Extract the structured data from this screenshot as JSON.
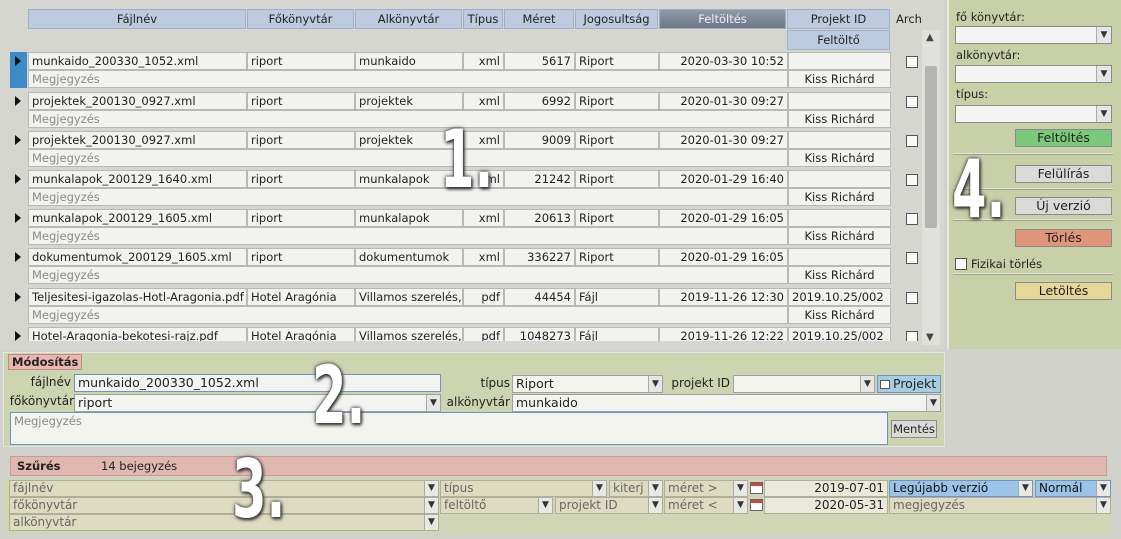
{
  "columns": {
    "filename": "Fájlnév",
    "main_dir": "Főkönyvtár",
    "sub_dir": "Alkönyvtár",
    "type": "Típus",
    "size": "Méret",
    "permission": "Jogosultság",
    "upload": "Feltöltés",
    "project_id": "Projekt ID",
    "archive": "Arch",
    "uploader": "Feltöltő"
  },
  "rows": [
    {
      "filename": "munkaido_200330_1052.xml",
      "main_dir": "riport",
      "sub_dir": "munkaido",
      "type": "xml",
      "size": "5617",
      "permission": "Riport",
      "upload": "2020-03-30 10:52",
      "project_id": "",
      "note": "Megjegyzés",
      "uploader": "Kiss Richárd"
    },
    {
      "filename": "projektek_200130_0927.xml",
      "main_dir": "riport",
      "sub_dir": "projektek",
      "type": "xml",
      "size": "6992",
      "permission": "Riport",
      "upload": "2020-01-30 09:27",
      "project_id": "",
      "note": "Megjegyzés",
      "uploader": "Kiss Richárd"
    },
    {
      "filename": "projektek_200130_0927.xml",
      "main_dir": "riport",
      "sub_dir": "projektek",
      "type": "xml",
      "size": "9009",
      "permission": "Riport",
      "upload": "2020-01-30 09:27",
      "project_id": "",
      "note": "Megjegyzés",
      "uploader": "Kiss Richárd"
    },
    {
      "filename": "munkalapok_200129_1640.xml",
      "main_dir": "riport",
      "sub_dir": "munkalapok",
      "type": "xml",
      "size": "21242",
      "permission": "Riport",
      "upload": "2020-01-29 16:40",
      "project_id": "",
      "note": "Megjegyzés",
      "uploader": "Kiss Richárd"
    },
    {
      "filename": "munkalapok_200129_1605.xml",
      "main_dir": "riport",
      "sub_dir": "munkalapok",
      "type": "xml",
      "size": "20613",
      "permission": "Riport",
      "upload": "2020-01-29 16:05",
      "project_id": "",
      "note": "Megjegyzés",
      "uploader": "Kiss Richárd"
    },
    {
      "filename": "dokumentumok_200129_1605.xml",
      "main_dir": "riport",
      "sub_dir": "dokumentumok",
      "type": "xml",
      "size": "336227",
      "permission": "Riport",
      "upload": "2020-01-29 16:05",
      "project_id": "",
      "note": "Megjegyzés",
      "uploader": "Kiss Richárd"
    },
    {
      "filename": "Teljesitesi-igazolas-Hotl-Aragonia.pdf",
      "main_dir": "Hotel Aragónia",
      "sub_dir": "Villamos szerelés,",
      "type": "pdf",
      "size": "44454",
      "permission": "Fájl",
      "upload": "2019-11-26 12:30",
      "project_id": "2019.10.25/002",
      "note": "Megjegyzés",
      "uploader": "Kiss Richárd"
    },
    {
      "filename": "Hotel-Aragonia-bekotesi-rajz.pdf",
      "main_dir": "Hotel Aragónia",
      "sub_dir": "Villamos szerelés,",
      "type": "pdf",
      "size": "1048273",
      "permission": "Fájl",
      "upload": "2019-11-26 12:22",
      "project_id": "2019.10.25/002",
      "note": "",
      "uploader": ""
    }
  ],
  "actions": {
    "main_dir_label": "fő könyvtár:",
    "sub_dir_label": "alkönyvtár:",
    "type_label": "típus:",
    "upload": "Feltöltés",
    "overwrite": "Felülírás",
    "new_version": "Új verzió",
    "delete": "Törlés",
    "physical_delete": "Fizikai törlés",
    "download": "Letöltés"
  },
  "modify": {
    "title": "Módosítás",
    "filename_label": "fájlnév",
    "filename_value": "munkaido_200330_1052.xml",
    "type_label": "típus",
    "type_value": "Riport",
    "project_id_label": "projekt ID",
    "project_button": "Projekt",
    "main_dir_label": "főkönyvtár",
    "main_dir_value": "riport",
    "sub_dir_label": "alkönyvtár",
    "sub_dir_value": "munkaido",
    "note_placeholder": "Megjegyzés",
    "save": "Mentés"
  },
  "filter": {
    "title": "Szűrés",
    "count": "14 bejegyzés",
    "filename": "fájlnév",
    "main_dir": "főkönyvtár",
    "sub_dir": "alkönyvtár",
    "type": "típus",
    "ext": "kiterj",
    "uploader": "feltöltő",
    "project_id": "projekt ID",
    "size_gt": "méret >",
    "size_lt": "méret <",
    "date_from": "2019-07-01",
    "date_to": "2020-05-31",
    "version": "Legújabb verzió",
    "mode": "Normál",
    "note": "megjegyzés"
  },
  "overlays": [
    "1.",
    "2.",
    "3.",
    "4."
  ],
  "colors": {
    "header_blue": "#bccbdf",
    "upload_green": "#7bc97b",
    "delete_red": "#e0967a",
    "download_yellow": "#e6d898",
    "selected_row": "#3d8ac9"
  }
}
